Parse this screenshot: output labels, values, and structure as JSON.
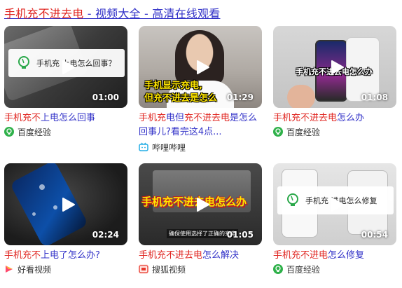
{
  "header": {
    "title_part1": "手机充不进去电",
    "title_part2": " - 视频大全 - 高清在线观看"
  },
  "videos": [
    {
      "title_red": "手机充不",
      "title_rest1": "上电",
      "title_rest2": "怎么回事",
      "duration": "01:00",
      "overlay": "手机充 上电怎么回事？",
      "source": "百度经验",
      "source_icon": "baidu-jingyan-icon"
    },
    {
      "title_a": "手机充",
      "title_b": "电但",
      "title_c": "充不进去电",
      "title_d": "是怎么回事儿?看完这4点...",
      "duration": "01:29",
      "overlay_line1": "手机显示充电,",
      "overlay_line2": "但充不进去是怎么",
      "source": "哔哩哔哩",
      "source_icon": "bilibili-icon"
    },
    {
      "title_red": "手机充不进去电",
      "title_rest": "怎么办",
      "duration": "01:08",
      "overlay": "手机充不进去电怎么办",
      "source": "百度经验",
      "source_icon": "baidu-jingyan-icon"
    },
    {
      "title_red": "手机充不",
      "title_rest": "上电了怎么办?",
      "duration": "02:24",
      "source": "好看视频",
      "source_icon": "haokan-icon"
    },
    {
      "title_red": "手机充不进去电",
      "title_rest": "怎么解决",
      "duration": "01:05",
      "overlay": "手机充不进去电怎么办",
      "overlay_small": "确保使用选择了正确的充电",
      "source": "搜狐视频",
      "source_icon": "sohu-icon"
    },
    {
      "title_red": "手机充不进电",
      "title_rest": "怎么修复",
      "duration": "00:54",
      "overlay": "手机充 进电怎么修复",
      "source": "百度经验",
      "source_icon": "baidu-jingyan-icon"
    }
  ]
}
